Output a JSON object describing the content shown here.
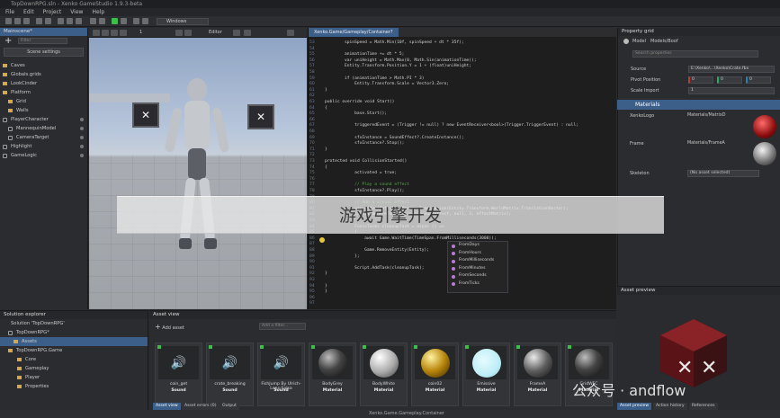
{
  "window": {
    "title": "TopDownRPG.sln - Xenko GameStudio 1.9.3-beta"
  },
  "menu": [
    "File",
    "Edit",
    "Project",
    "View",
    "Help"
  ],
  "toolbar": {
    "platform": "Windows",
    "camera_count": "1",
    "mode": "Editor"
  },
  "scene_panel": {
    "tab": "Mainscene*",
    "filter_placeholder": "Filter",
    "scene_settings": "Scene settings",
    "items": [
      "Caves",
      "Globals.grids",
      "LookCinder",
      "Platform",
      "Grid",
      "Walls",
      "PlayerCharacter",
      "MannequinModel",
      "CameraTarget",
      "Highlight",
      "GameLogic"
    ]
  },
  "code_editor": {
    "tabs": [
      "Xenko.Game/Gameplay/Container?",
      "Xenko.Game/Gameplay/Container?"
    ],
    "line_numbers": [
      "53",
      "54",
      "55",
      "56",
      "57",
      "58",
      "59",
      "60",
      "61",
      "62",
      "63",
      "64",
      "65",
      "66",
      "67",
      "68",
      "69",
      "70",
      "71",
      "72",
      "73",
      "74",
      "75",
      "76",
      "77",
      "78",
      "79",
      "80",
      "81",
      "82",
      "83",
      "84",
      "85",
      "86",
      "87",
      "88",
      "89",
      "90",
      "91",
      "92",
      "93",
      "94",
      "95",
      "96",
      "97"
    ],
    "lines": [
      "spinSpeed = Math.Min(10f, spinSpeed + dt * 35f);",
      "",
      "animationTime += dt * 5;",
      "var uniHeight = Math.Max(0, Math.Sin(animationTime));",
      "Entity.Transform.Position.Y = 1 + (float)uniHeight;",
      "",
      "if (animationTime > Math.PI * 3)",
      "    Entity.Transform.Scale = Vector3.Zero;",
      "}",
      "",
      "public override void Start()",
      "{",
      "    base.Start();",
      "",
      "    triggeredEvent = (Trigger != null) ? new EventReceiver<bool>(Trigger.TriggerEvent) : null;",
      "",
      "    sfxInstance = SoundEffect?.CreateInstance();",
      "    sfxInstance?.Stop();",
      "}",
      "",
      "protected void CollisionStarted()",
      "{",
      "    activated = true;",
      "",
      "    // Play a sound effect",
      "    sfxInstance?.Play();",
      "",
      "    // Add a visual effect",
      "    var effectMatrix = Matrix.Translation(Entity.Transform.WorldMatrix.TranslationVector);",
      "    this.SpawnPrefabInstance(CoinGetEffect, null, 3, effectMatrix);",
      "",
      "    Func<Task> cleanupTask = async () =>",
      "    {",
      "        await Game.WaitTime(TimeSpan.FromMilliseconds(3000));",
      "",
      "        Game.RemoveEntity(Entity);",
      "    };",
      "",
      "    Script.AddTask(cleanupTask);",
      "}",
      "",
      "}",
      "}"
    ],
    "intellisense": [
      "FromDays",
      "FromHours",
      "FromMilliseconds",
      "FromMinutes",
      "FromSeconds",
      "FromTicks"
    ]
  },
  "property_grid": {
    "title": "Property grid",
    "entity_label": "Model",
    "entity_value": "Models/Boof",
    "search_placeholder": "Search properties",
    "rows": [
      {
        "label": "Source",
        "value": "E:\\Xenko\\...\\Xenko\\Crate.fbx"
      },
      {
        "label": "Pivot Position",
        "x": "0",
        "y": "0",
        "z": "0"
      },
      {
        "label": "Scale Import",
        "value": "1"
      }
    ],
    "materials_header": "Materials",
    "materials": [
      {
        "label": "XenkoLogo",
        "value": "Materials/MatrixD"
      },
      {
        "label": "Frame",
        "value": "Materials/FrameA"
      },
      {
        "label": "Skeleton",
        "value": "(No asset selected)"
      }
    ]
  },
  "asset_preview": {
    "title": "Asset preview",
    "tabs": [
      "Asset preview",
      "Action history",
      "References"
    ]
  },
  "solution_explorer": {
    "title": "Solution explorer",
    "items": [
      "Solution 'TopDownRPG'",
      "TopDownRPG*",
      "Assets",
      "TopDownRPG.Game",
      "Core",
      "Gameplay",
      "Player",
      "Properties"
    ]
  },
  "asset_view": {
    "title": "Asset view",
    "add_asset": "Add asset",
    "filter_placeholder": "Add a filter...",
    "assets": [
      {
        "name": "coin_get",
        "type": "Sound",
        "kind": "sound"
      },
      {
        "name": "crate_breaking",
        "type": "Sound",
        "kind": "sound"
      },
      {
        "name": "FishJump By Ulrich-Lens-Salsa",
        "type": "Sound",
        "kind": "sound"
      },
      {
        "name": "BodyGrey",
        "type": "Material",
        "kind": "dark"
      },
      {
        "name": "BodyWhite",
        "type": "Material",
        "kind": "white"
      },
      {
        "name": "coin02",
        "type": "Material",
        "kind": "gold"
      },
      {
        "name": "Emissive",
        "type": "Material",
        "kind": "emissive"
      },
      {
        "name": "FrameA",
        "type": "Material",
        "kind": "frame"
      },
      {
        "name": "GridWFC",
        "type": "Material",
        "kind": "dark"
      }
    ],
    "bottom_tabs": [
      "Asset view",
      "Asset errors (0)",
      "Output"
    ]
  },
  "status": {
    "text": "Xenko.Game.Gameplay.Container"
  },
  "overlay": {
    "banner": "游戏引擎开发",
    "watermark": "公众号 · andflow"
  }
}
